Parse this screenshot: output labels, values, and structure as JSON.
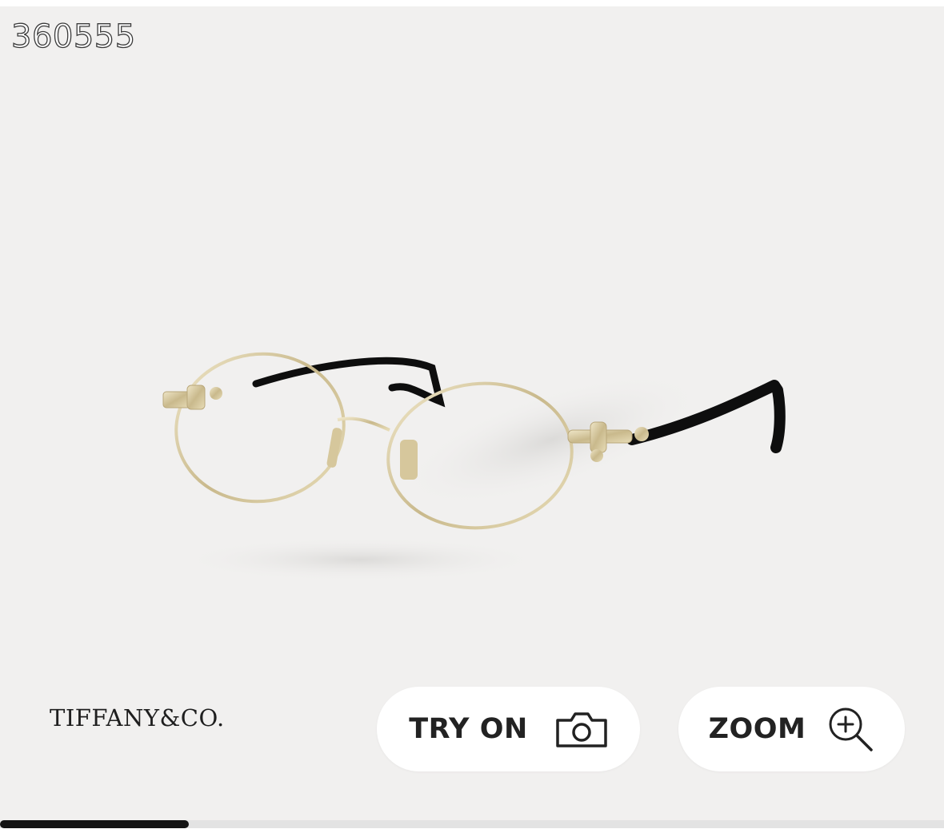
{
  "overlay": {
    "product_code": "360555"
  },
  "product_image": {
    "subject": "gold-oval-eyeglasses-icon",
    "frame_color": "#d8cca8",
    "temple_color": "#111111"
  },
  "brand": {
    "logo_text": "TIFFANY&CO."
  },
  "actions": {
    "try_on": {
      "label": "TRY ON",
      "icon": "camera-icon"
    },
    "zoom": {
      "label": "ZOOM",
      "icon": "zoom-in-icon"
    }
  },
  "gallery": {
    "scroll_progress": 0.2
  },
  "colors": {
    "background": "#f1f0ef",
    "button_bg": "#ffffff",
    "text": "#222222",
    "scroll_thumb": "#141414"
  }
}
